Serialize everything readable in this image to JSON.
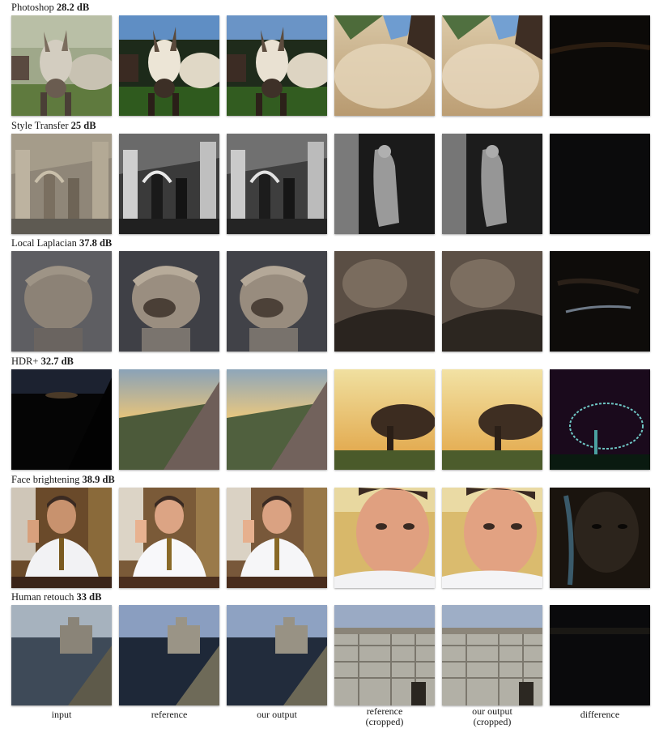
{
  "columns": [
    "input",
    "reference",
    "our output",
    "reference\n(cropped)",
    "our output\n(cropped)",
    "difference"
  ],
  "rows": [
    {
      "name": "Photoshop",
      "psnr": "28.2 dB"
    },
    {
      "name": "Style Transfer",
      "psnr": "25 dB"
    },
    {
      "name": "Local Laplacian",
      "psnr": "37.8 dB"
    },
    {
      "name": "HDR+",
      "psnr": "32.7 dB"
    },
    {
      "name": "Face brightening",
      "psnr": "38.9 dB"
    },
    {
      "name": "Human retouch",
      "psnr": "33 dB"
    }
  ]
}
